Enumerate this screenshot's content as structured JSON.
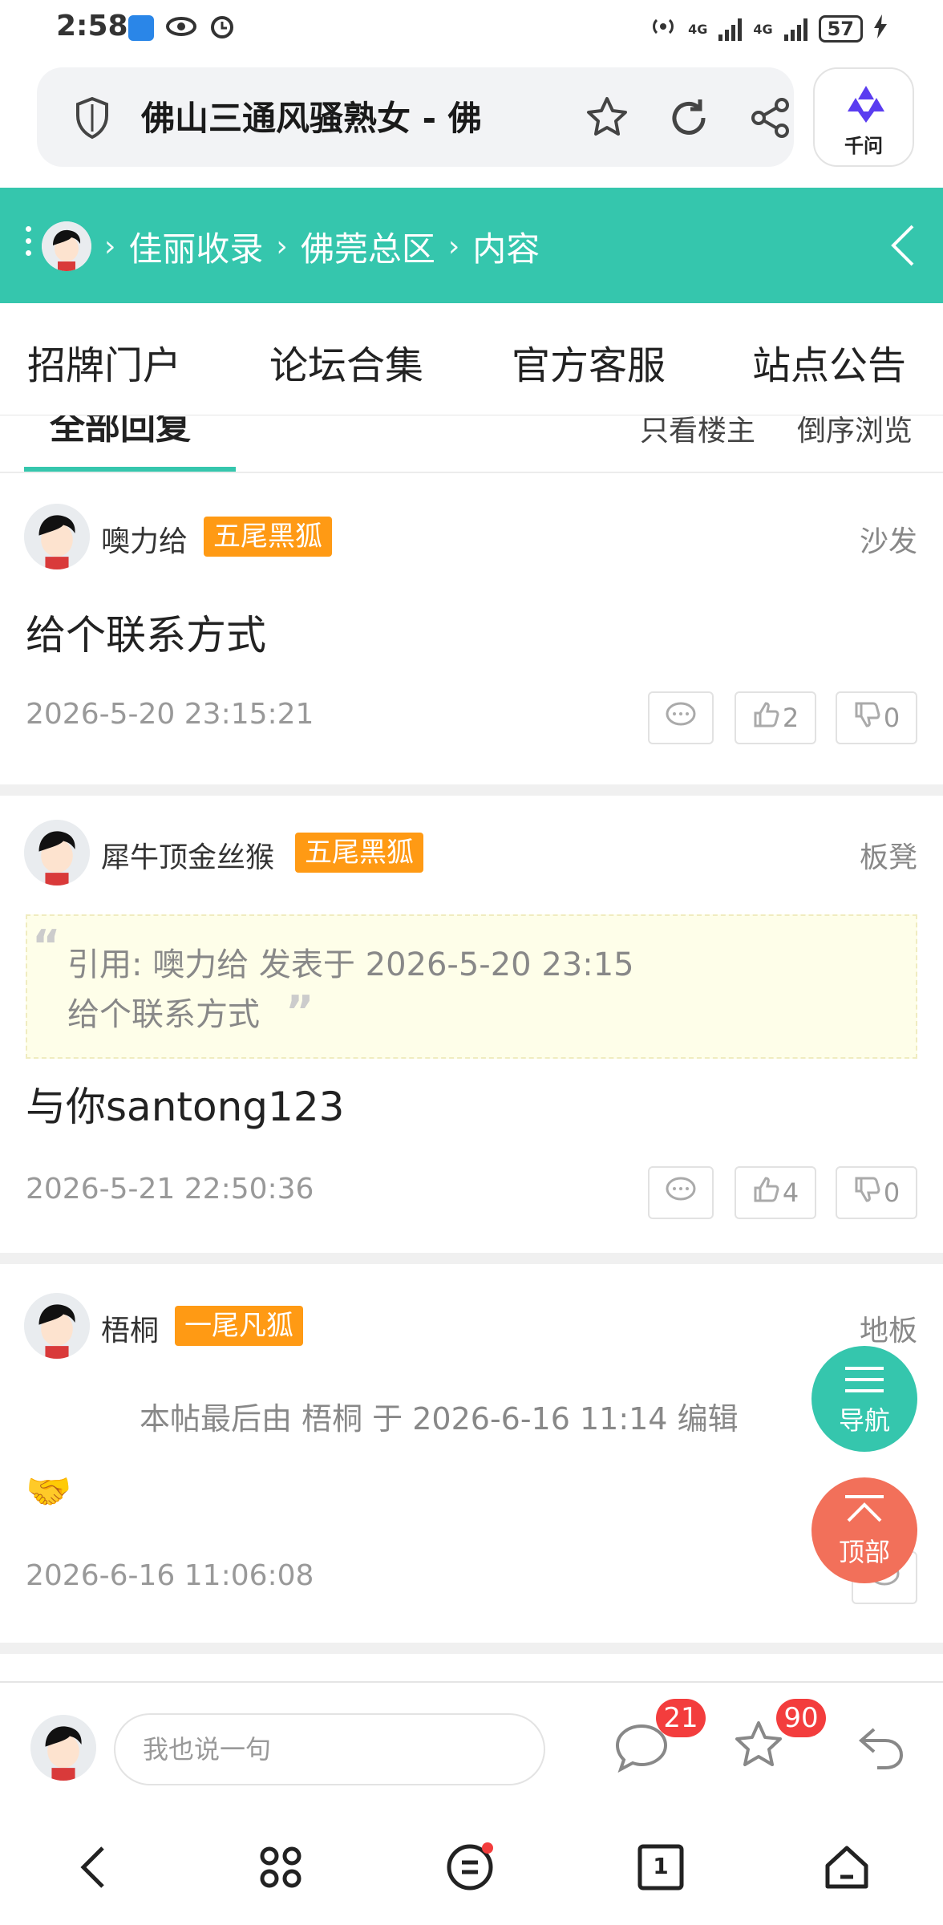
{
  "status_bar": {
    "time": "2:58",
    "network_1": "4G",
    "network_2": "4G",
    "battery": "57"
  },
  "browser": {
    "page_title": "佛山三通风骚熟女 - 佛",
    "ai_label": "千问"
  },
  "breadcrumb": {
    "items": [
      "佳丽收录",
      "佛莞总区",
      "内容"
    ],
    "separator": "›"
  },
  "top_tabs": [
    "招牌门户",
    "论坛合集",
    "官方客服",
    "站点公告"
  ],
  "sub_tabs": {
    "all_replies": "全部回复",
    "only_op": "只看楼主",
    "reverse": "倒序浏览"
  },
  "posts": [
    {
      "user": "噢力给",
      "rank": "五尾黑狐",
      "floor": "沙发",
      "content": "给个联系方式",
      "date": "2026-5-20 23:15:21",
      "likes": "2",
      "dislikes": "0"
    },
    {
      "user": "犀牛顶金丝猴",
      "rank": "五尾黑狐",
      "floor": "板凳",
      "quote_line1": "引用: 噢力给 发表于 2026-5-20 23:15",
      "quote_line2": "给个联系方式",
      "content": "与你santong123",
      "date": "2026-5-21 22:50:36",
      "likes": "4",
      "dislikes": "0"
    },
    {
      "user": "梧桐",
      "rank": "一尾凡狐",
      "floor": "地板",
      "edit_note": "本帖最后由 梧桐 于 2026-6-16 11:14 编辑",
      "content": "🤝",
      "date": "2026-6-16 11:06:08"
    }
  ],
  "floating": {
    "nav_label": "导航",
    "top_label": "顶部"
  },
  "reply_bar": {
    "placeholder": "我也说一句",
    "comment_count": "21",
    "favorite_count": "90"
  },
  "bottom_nav": {
    "tab_count": "1"
  },
  "colors": {
    "accent": "#35c6ad",
    "badge": "#ff9a14",
    "top_button": "#f2705a",
    "count_badge": "#f33d3d"
  }
}
